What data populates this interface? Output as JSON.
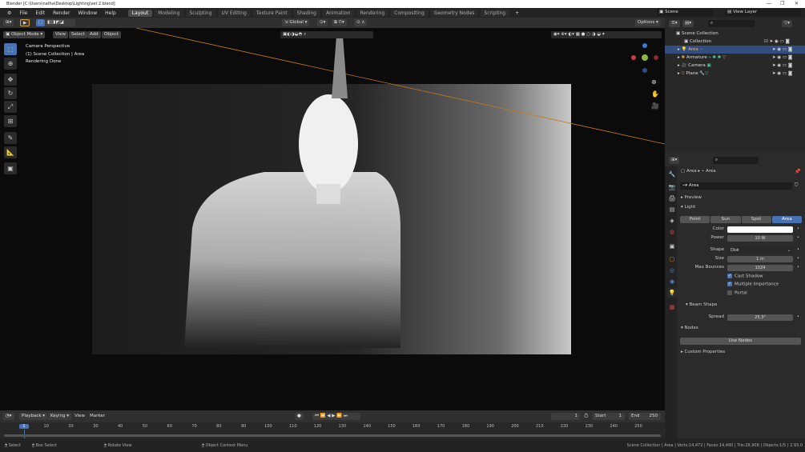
{
  "window": {
    "title": "Blender [C:\\Users\\natha\\Desktop\\Lighting\\set 2.blend]",
    "min": "—",
    "max": "❐",
    "close": "✕"
  },
  "menu": [
    "File",
    "Edit",
    "Render",
    "Window",
    "Help"
  ],
  "workspaces": [
    "Layout",
    "Modeling",
    "Sculpting",
    "UV Editing",
    "Texture Paint",
    "Shading",
    "Animation",
    "Rendering",
    "Compositing",
    "Geometry Nodes",
    "Scripting"
  ],
  "scene": {
    "name": "Scene",
    "view_layer": "View Layer"
  },
  "viewport": {
    "mode": "Object Mode",
    "menus": [
      "View",
      "Select",
      "Add",
      "Object"
    ],
    "orientation": "Global",
    "options": "Options",
    "overlay_lines": [
      "Camera Perspective",
      "(1) Scene Collection | Area",
      "Rendering Done"
    ]
  },
  "outliner": {
    "root": "Scene Collection",
    "items": [
      {
        "name": "Collection"
      },
      {
        "name": "Area",
        "selected": true
      },
      {
        "name": "Armature"
      },
      {
        "name": "Camera"
      },
      {
        "name": "Plane"
      }
    ]
  },
  "properties": {
    "breadcrumb": [
      "Area",
      "Area"
    ],
    "datablock": "Area",
    "panels": {
      "preview": "Preview",
      "light": "Light",
      "beam": "Beam Shape",
      "nodes": "Nodes",
      "custom": "Custom Properties"
    },
    "light_types": [
      "Point",
      "Sun",
      "Spot",
      "Area"
    ],
    "active_type": "Area",
    "fields": {
      "color_label": "Color",
      "color": "#ffffff",
      "power_label": "Power",
      "power": "10 W",
      "shape_label": "Shape",
      "shape": "Disk",
      "size_label": "Size",
      "size": "1 m",
      "bounces_label": "Max Bounces",
      "bounces": "1024",
      "spread_label": "Spread",
      "spread": "25.3°"
    },
    "checks": {
      "cast_shadow": "Cast Shadow",
      "multiple_importance": "Multiple Importance",
      "portal": "Portal"
    },
    "use_nodes": "Use Nodes"
  },
  "timeline": {
    "menus": [
      "Playback",
      "Keying",
      "View",
      "Marker"
    ],
    "current_frame": "1",
    "start_label": "Start",
    "start": "1",
    "end_label": "End",
    "end": "250",
    "ticks": [
      "1",
      "10",
      "20",
      "30",
      "40",
      "50",
      "60",
      "70",
      "80",
      "90",
      "100",
      "110",
      "120",
      "130",
      "140",
      "150",
      "160",
      "170",
      "180",
      "190",
      "200",
      "210",
      "220",
      "230",
      "240",
      "250"
    ]
  },
  "status": {
    "select": "Select",
    "box_select": "Box Select",
    "rotate": "Rotate View",
    "context": "Object Context Menu",
    "info": "Scene Collection | Area | Verts:14,472 | Faces:14,480 | Tris:28,908 | Objects:1/5 | 2.93.0"
  }
}
